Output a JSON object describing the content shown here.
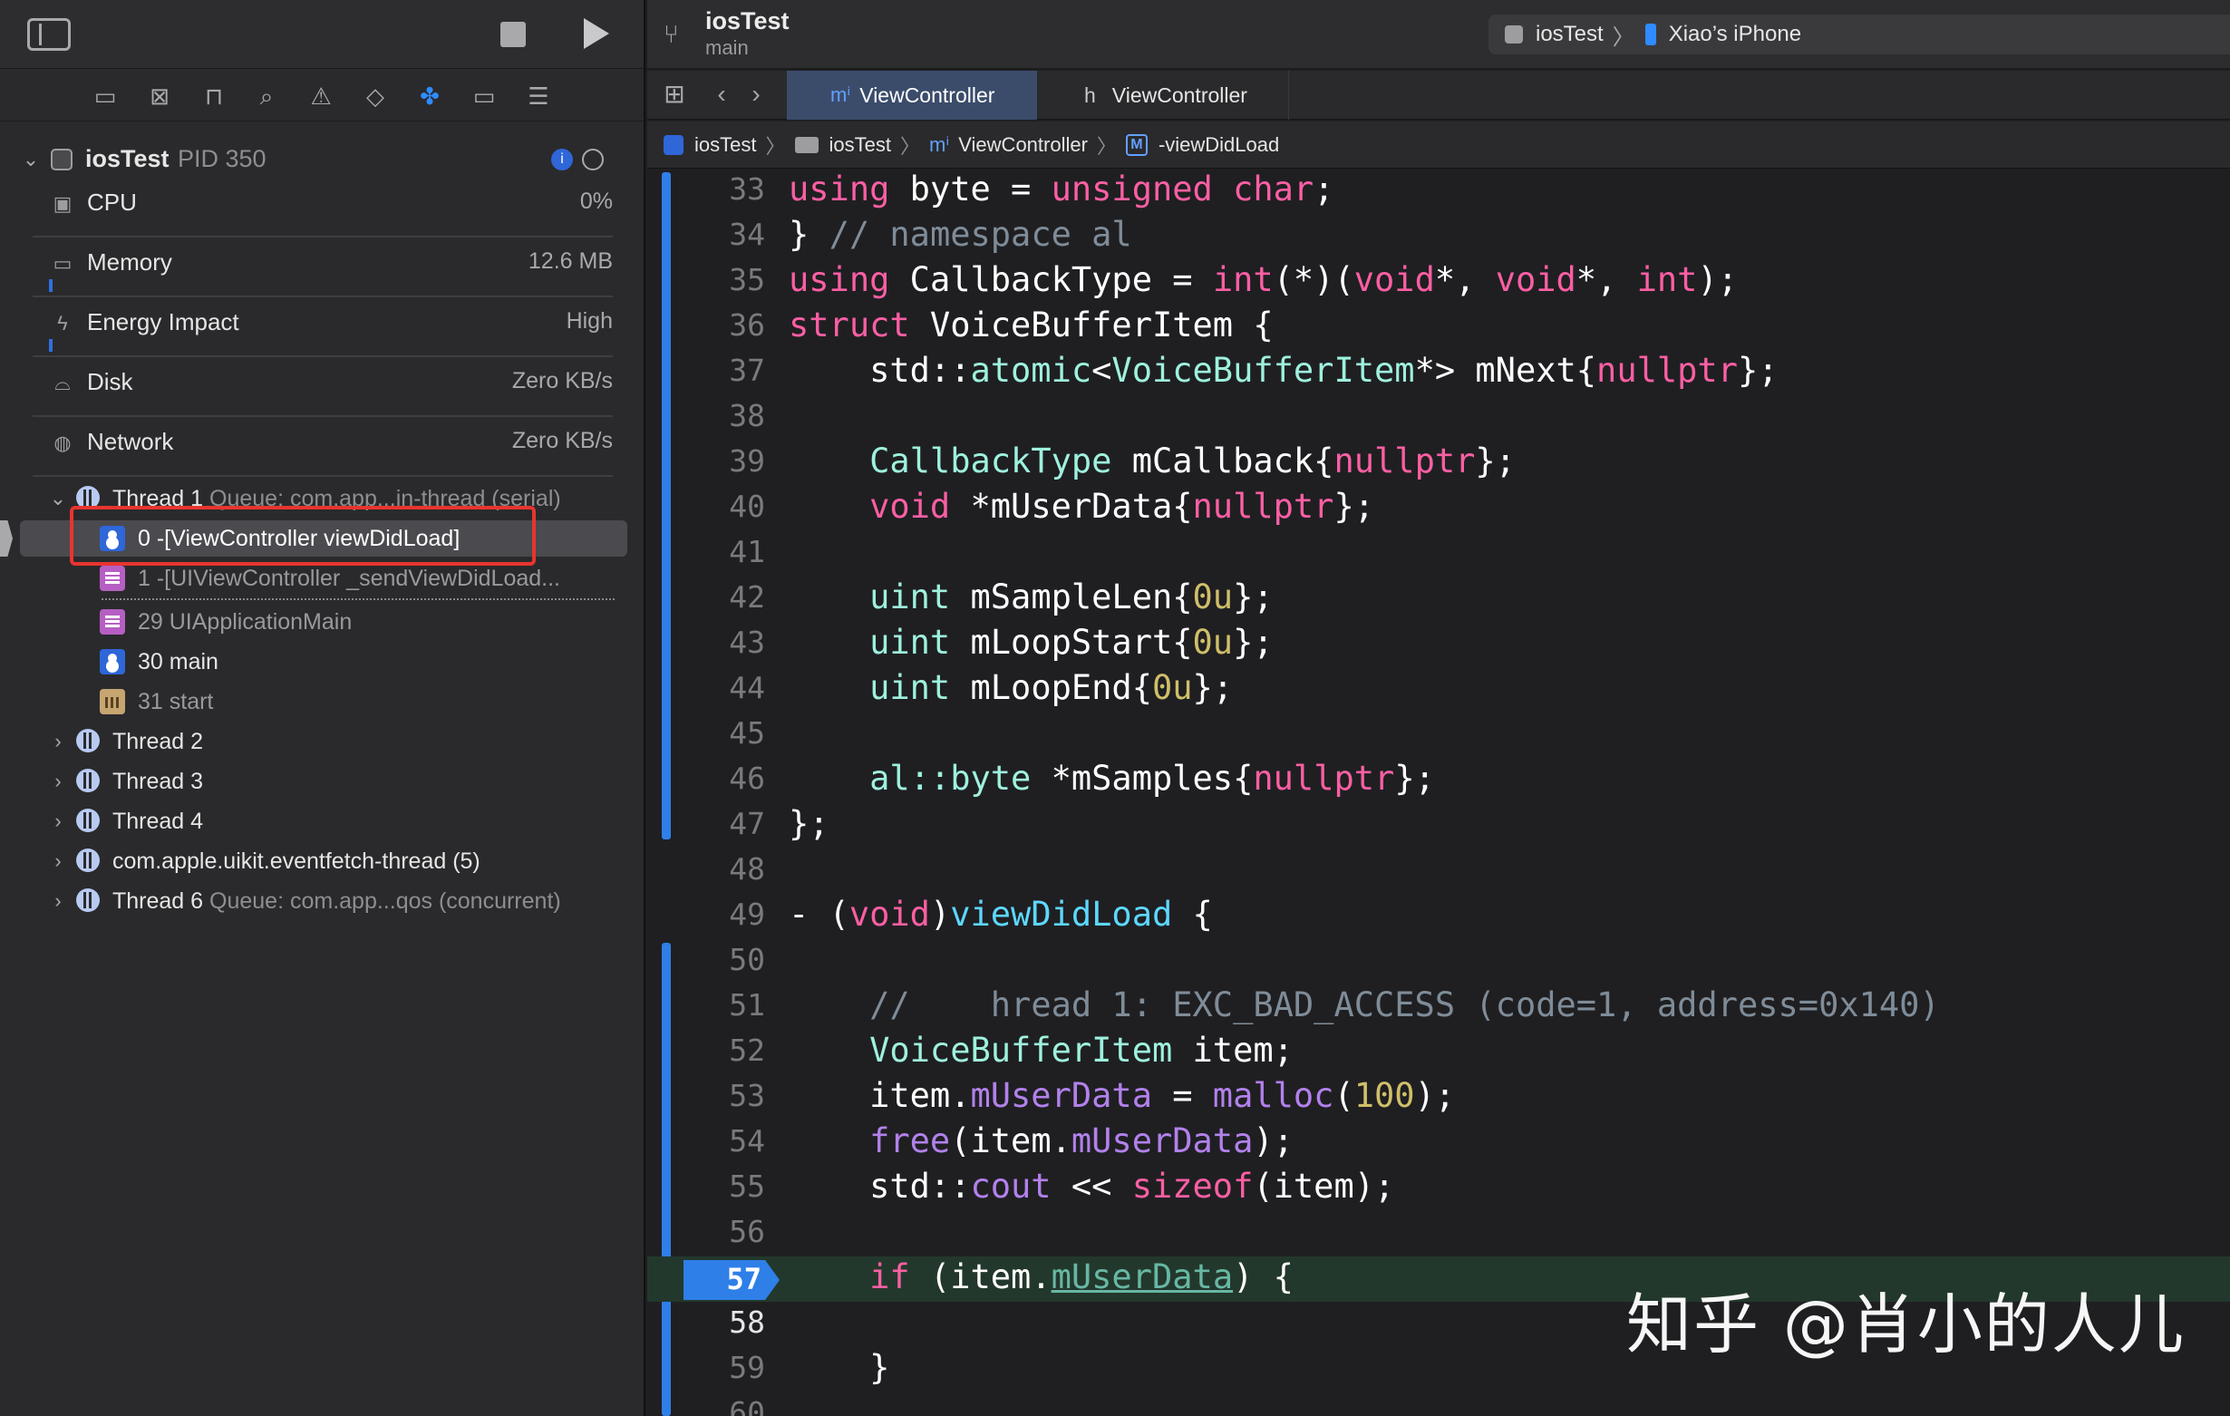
{
  "debug_navigator": {
    "process": {
      "name": "iosTest",
      "pid": "PID 350"
    },
    "gauges": [
      {
        "label": "CPU",
        "value": "0%"
      },
      {
        "label": "Memory",
        "value": "12.6 MB"
      },
      {
        "label": "Energy Impact",
        "value": "High"
      },
      {
        "label": "Disk",
        "value": "Zero KB/s"
      },
      {
        "label": "Network",
        "value": "Zero KB/s"
      }
    ],
    "thread1": {
      "name": "Thread 1",
      "queue": "Queue: com.app...in-thread (serial)"
    },
    "frames": [
      {
        "label": "0 -[ViewController viewDidLoad]",
        "kind": "user"
      },
      {
        "label": "1 -[UIViewController _sendViewDidLoad...",
        "kind": "library"
      },
      {
        "label": "29 UIApplicationMain",
        "kind": "library"
      },
      {
        "label": "30 main",
        "kind": "user"
      },
      {
        "label": "31 start",
        "kind": "system"
      }
    ],
    "threads": [
      {
        "name": "Thread 2",
        "queue": ""
      },
      {
        "name": "Thread 3",
        "queue": ""
      },
      {
        "name": "Thread 4",
        "queue": ""
      },
      {
        "name": "com.apple.uikit.eventfetch-thread (5)",
        "queue": ""
      },
      {
        "name": "Thread 6",
        "queue": "Queue: com.app...qos (concurrent)"
      }
    ]
  },
  "toolbar": {
    "project_title": "iosTest",
    "branch": "main",
    "scheme_target": "iosTest",
    "scheme_device": "Xiao’s iPhone"
  },
  "tabs": [
    {
      "label": "ViewController",
      "icon": "m",
      "active": true
    },
    {
      "label": "ViewController",
      "icon": "h",
      "active": false
    }
  ],
  "jump_bar": [
    "iosTest",
    "iosTest",
    "ViewController",
    "-viewDidLoad"
  ],
  "code_lines": [
    {
      "n": "33"
    },
    {
      "n": "34"
    },
    {
      "n": "35"
    },
    {
      "n": "36"
    },
    {
      "n": "37"
    },
    {
      "n": "38"
    },
    {
      "n": "39"
    },
    {
      "n": "40"
    },
    {
      "n": "41"
    },
    {
      "n": "42"
    },
    {
      "n": "43"
    },
    {
      "n": "44"
    },
    {
      "n": "45"
    },
    {
      "n": "46"
    },
    {
      "n": "47"
    },
    {
      "n": "48"
    },
    {
      "n": "49"
    },
    {
      "n": "50"
    },
    {
      "n": "51"
    },
    {
      "n": "52"
    },
    {
      "n": "53"
    },
    {
      "n": "54"
    },
    {
      "n": "55"
    },
    {
      "n": "56"
    },
    {
      "n": "57"
    },
    {
      "n": "58"
    },
    {
      "n": "59"
    },
    {
      "n": "60"
    }
  ],
  "code": {
    "l33": [
      "using",
      " byte = ",
      "unsigned",
      " ",
      "char",
      ";"
    ],
    "l34": [
      "} ",
      "// namespace al"
    ],
    "l35": [
      "using",
      " CallbackType = ",
      "int",
      "(*)(",
      "void",
      "*, ",
      "void",
      "*, ",
      "int",
      ");"
    ],
    "l36": [
      "struct",
      " VoiceBufferItem {"
    ],
    "l37": [
      "    std::",
      "atomic",
      "<",
      "VoiceBufferItem",
      "*> mNext{",
      "nullptr",
      "};"
    ],
    "l39": [
      "    ",
      "CallbackType",
      " mCallback{",
      "nullptr",
      "};"
    ],
    "l40": [
      "    ",
      "void",
      " *mUserData{",
      "nullptr",
      "};"
    ],
    "l42": [
      "    ",
      "uint",
      " mSampleLen{",
      "0u",
      "};"
    ],
    "l43": [
      "    ",
      "uint",
      " mLoopStart{",
      "0u",
      "};"
    ],
    "l44": [
      "    ",
      "uint",
      " mLoopEnd{",
      "0u",
      "};"
    ],
    "l46": [
      "    ",
      "al::byte",
      " *mSamples{",
      "nullptr",
      "};"
    ],
    "l47": [
      "};"
    ],
    "l49": [
      "- (",
      "void",
      ")",
      "viewDidLoad",
      " {"
    ],
    "l51": [
      "    ",
      "//    hread 1: EXC_BAD_ACCESS (code=1, address=0x140)"
    ],
    "l52": [
      "    ",
      "VoiceBufferItem",
      " item;"
    ],
    "l53": [
      "    item.",
      "mUserData",
      " = ",
      "malloc",
      "(",
      "100",
      ");"
    ],
    "l54": [
      "    ",
      "free",
      "(item.",
      "mUserData",
      ");"
    ],
    "l55": [
      "    std::",
      "cout",
      " << ",
      "sizeof",
      "(item);"
    ],
    "l57": [
      "    ",
      "if",
      " (item.",
      "mUserData",
      ") {"
    ],
    "l59": [
      "    }"
    ]
  },
  "current_line": "57",
  "watermark": "知乎 @肖小的人儿",
  "colors": {
    "keyword": "#fc5fa3",
    "type": "#5dd8ff",
    "comment": "#7f8c98",
    "number": "#d0bf69",
    "accent_blue": "#2f7fe8",
    "highlight_red": "#e8342f",
    "pc_line_bg": "#23382c"
  }
}
